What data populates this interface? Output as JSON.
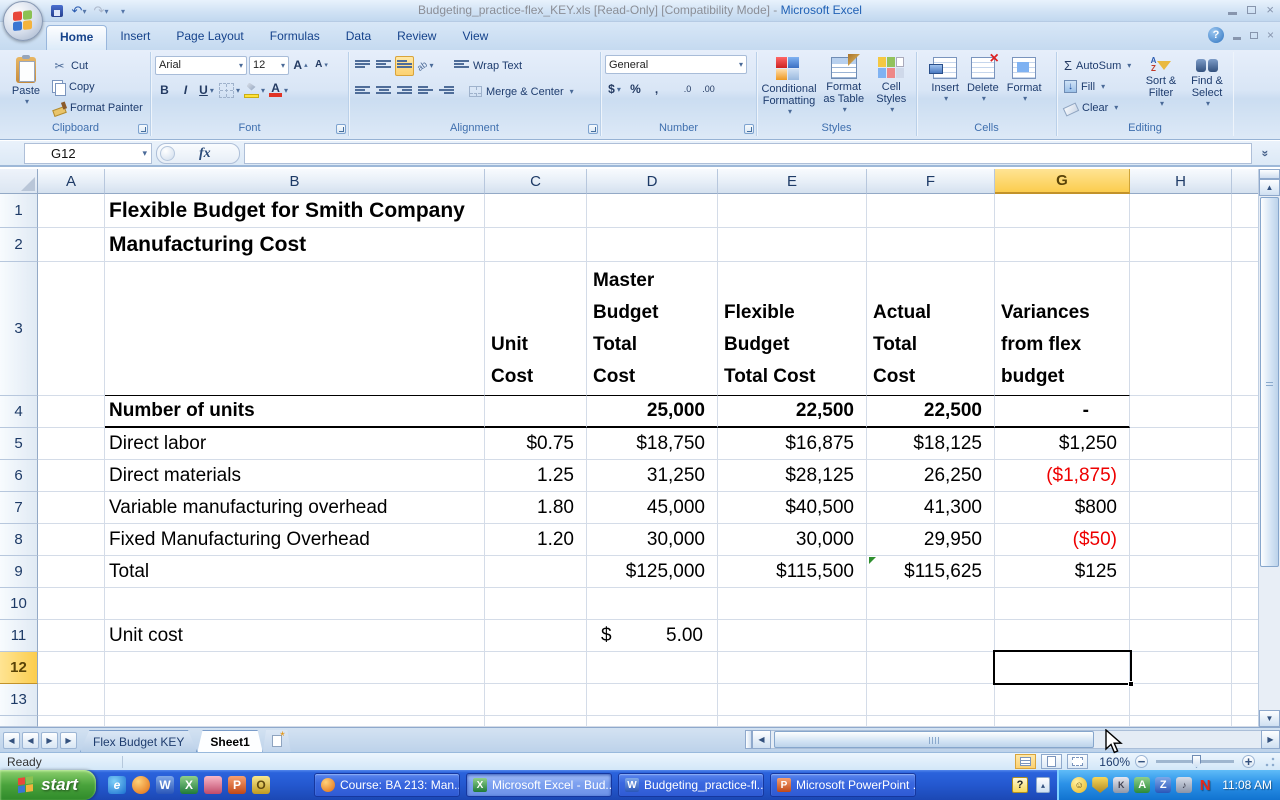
{
  "titlebar": {
    "title_file": "Budgeting_practice-flex_KEY.xls  [Read-Only]  [Compatibility Mode] - ",
    "title_app": "Microsoft Excel"
  },
  "ribbon": {
    "tabs": [
      {
        "label": "Home"
      },
      {
        "label": "Insert"
      },
      {
        "label": "Page Layout"
      },
      {
        "label": "Formulas"
      },
      {
        "label": "Data"
      },
      {
        "label": "Review"
      },
      {
        "label": "View"
      }
    ],
    "clipboard": {
      "label": "Clipboard",
      "paste": "Paste",
      "cut": "Cut",
      "copy": "Copy",
      "format_painter": "Format Painter"
    },
    "font": {
      "label": "Font",
      "name": "Arial",
      "size": "12",
      "bold": "B",
      "italic": "I",
      "underline": "U",
      "grow": "A",
      "shrink": "A",
      "color_letter": "A"
    },
    "alignment": {
      "label": "Alignment",
      "wrap": "Wrap Text",
      "merge": "Merge & Center"
    },
    "number": {
      "label": "Number",
      "format": "General",
      "currency": "$",
      "percent": "%",
      "comma": ",",
      "inc_decimal": ".0",
      "dec_decimal": ".00"
    },
    "styles": {
      "label": "Styles",
      "conditional": "Conditional Formatting",
      "format_table": "Format as Table",
      "cell_styles": "Cell Styles"
    },
    "cells": {
      "label": "Cells",
      "insert": "Insert",
      "delete": "Delete",
      "format": "Format"
    },
    "editing": {
      "label": "Editing",
      "autosum": "AutoSum",
      "fill": "Fill",
      "clear": "Clear",
      "sort_filter": "Sort & Filter",
      "find_select": "Find & Select"
    }
  },
  "formula_bar": {
    "name_box": "G12",
    "fx": "fx",
    "formula": ""
  },
  "sheet": {
    "selected_cell": "G12",
    "columns": [
      "A",
      "B",
      "C",
      "D",
      "E",
      "F",
      "G",
      "H"
    ],
    "row_numbers": [
      "1",
      "2",
      "3",
      "4",
      "5",
      "6",
      "7",
      "8",
      "9",
      "10",
      "11",
      "12",
      "13"
    ],
    "rows": {
      "r1": {
        "B": "Flexible Budget for Smith Company"
      },
      "r2": {
        "B": "Manufacturing Cost"
      },
      "r3": {
        "C": "Unit\nCost",
        "D": "Master\nBudget\nTotal\nCost",
        "E": "Flexible\nBudget\nTotal Cost",
        "F": "Actual\nTotal\nCost",
        "G": "Variances\nfrom flex\nbudget"
      },
      "r4": {
        "B": "Number of units",
        "D": "25,000",
        "E": "22,500",
        "F": "22,500",
        "G": "-"
      },
      "r5": {
        "B": "Direct labor",
        "C": "$0.75",
        "D": "$18,750",
        "E": "$16,875",
        "F": "$18,125",
        "G": "$1,250"
      },
      "r6": {
        "B": "Direct materials",
        "C": "1.25",
        "D": "31,250",
        "E": "$28,125",
        "F": "26,250",
        "G": "($1,875)"
      },
      "r7": {
        "B": "Variable manufacturing overhead",
        "C": "1.80",
        "D": "45,000",
        "E": "$40,500",
        "F": "41,300",
        "G": "$800"
      },
      "r8": {
        "B": "Fixed Manufacturing Overhead",
        "C": "1.20",
        "D": "30,000",
        "E": "30,000",
        "F": "29,950",
        "G": "($50)"
      },
      "r9": {
        "B": "Total",
        "D": "$125,000",
        "E": "$115,500",
        "F": "$115,625",
        "G": "$125"
      },
      "r11": {
        "B": "Unit cost",
        "D_currency": "$",
        "D_value": "5.00"
      }
    }
  },
  "sheet_tabs": {
    "tabs": [
      {
        "label": "Flex Budget KEY"
      },
      {
        "label": "Sheet1"
      }
    ]
  },
  "status_bar": {
    "mode": "Ready",
    "zoom": "160%"
  },
  "taskbar": {
    "start_label": "start",
    "tasks": [
      {
        "label": "Course: BA 213: Man...",
        "app": "firefox"
      },
      {
        "label": "Microsoft Excel - Bud...",
        "app": "excel"
      },
      {
        "label": "Budgeting_practice-fl...",
        "app": "word"
      },
      {
        "label": "Microsoft PowerPoint ...",
        "app": "powerpoint"
      }
    ],
    "clock": "11:08 AM"
  },
  "icons": {
    "dropdown": "▾",
    "scissors": "✂",
    "sigma": "Σ",
    "undo": "↶",
    "redo": "↷",
    "left": "◀",
    "right": "▶",
    "up": "▲",
    "down": "▼",
    "close": "×",
    "question": "?",
    "chevron_double": "»",
    "smiley": "☺",
    "minus": "−",
    "plus": "+",
    "ie": "e",
    "word": "W",
    "excel": "X",
    "ppt": "P",
    "outlook": "O",
    "key": "K",
    "a": "A",
    "z": "Z",
    "n": "N",
    "spk": "♪"
  }
}
